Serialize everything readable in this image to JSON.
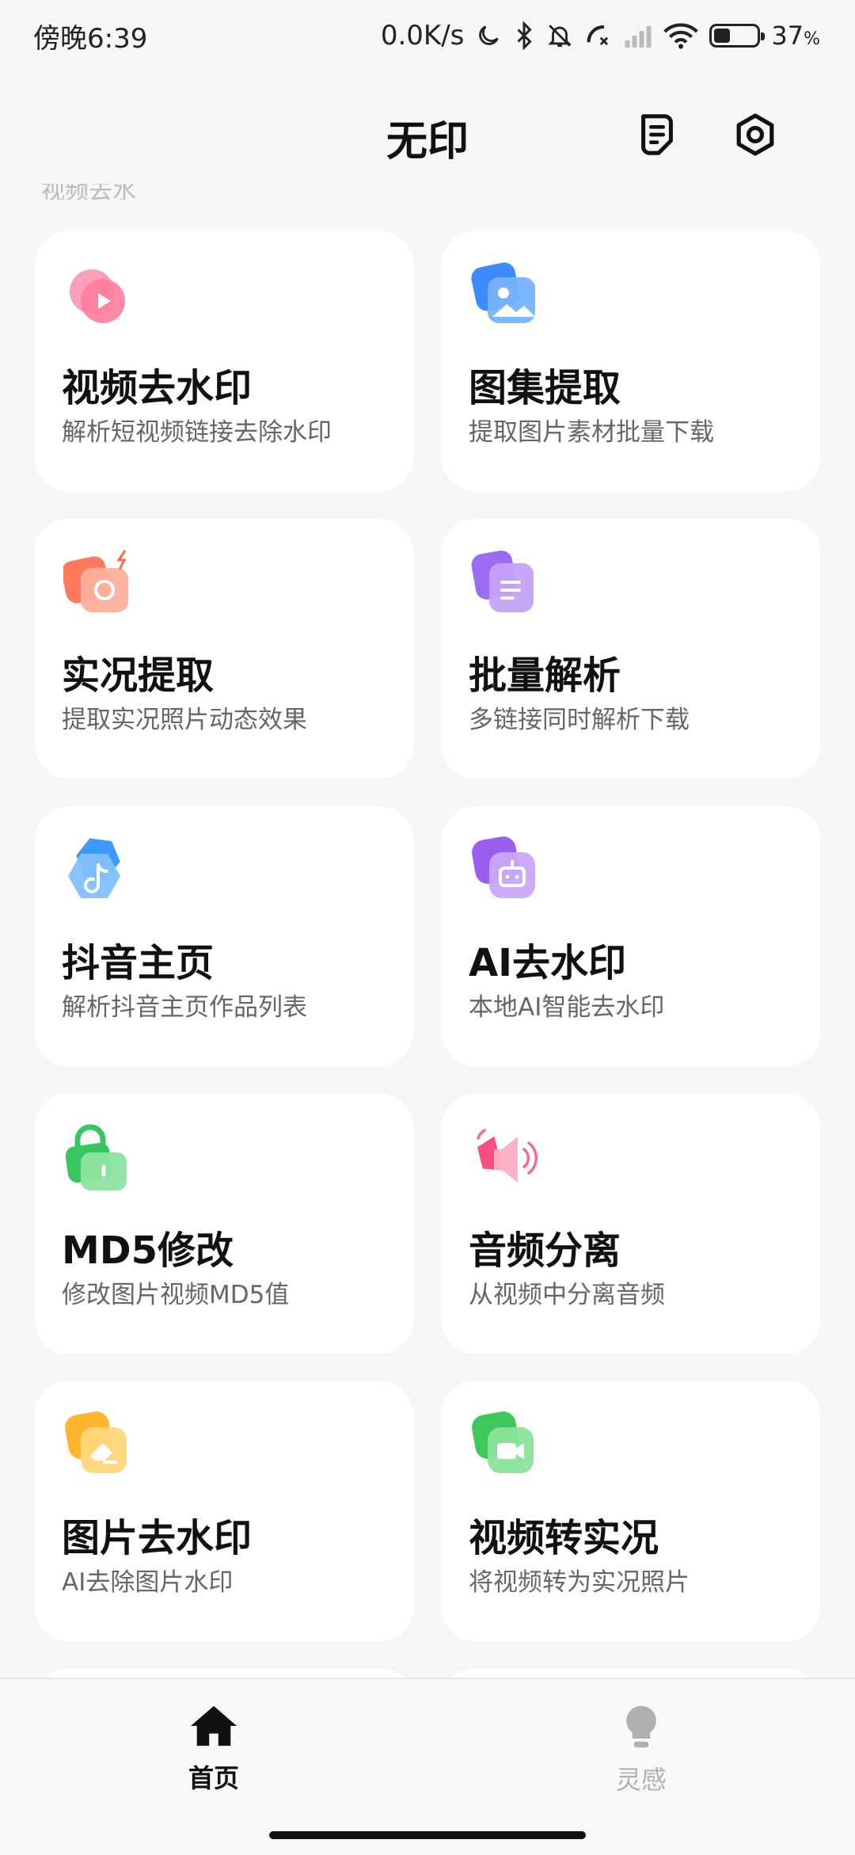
{
  "status": {
    "time": "傍晚6:39",
    "net_speed": "0.0K/s",
    "battery_pct": "37",
    "battery_unit": "%",
    "battery_level": 0.37
  },
  "header": {
    "title": "无印",
    "peek_text": "视频去水"
  },
  "tools": [
    {
      "title": "视频去水印",
      "subtitle": "解析短视频链接去除水印",
      "icon": "video-play-icon",
      "color": "#f5507f"
    },
    {
      "title": "图集提取",
      "subtitle": "提取图片素材批量下载",
      "icon": "image-gallery-icon",
      "color": "#3d8bff"
    },
    {
      "title": "实况提取",
      "subtitle": "提取实况照片动态效果",
      "icon": "live-camera-icon",
      "color": "#ff7a5c"
    },
    {
      "title": "批量解析",
      "subtitle": "多链接同时解析下载",
      "icon": "document-stack-icon",
      "color": "#9b6bf2"
    },
    {
      "title": "抖音主页",
      "subtitle": "解析抖音主页作品列表",
      "icon": "tiktok-icon",
      "color": "#3d9bff"
    },
    {
      "title": "AI去水印",
      "subtitle": "本地AI智能去水印",
      "icon": "robot-icon",
      "color": "#9a5ff0"
    },
    {
      "title": "MD5修改",
      "subtitle": "修改图片视频MD5值",
      "icon": "lock-icon",
      "color": "#38c75e"
    },
    {
      "title": "音频分离",
      "subtitle": "从视频中分离音频",
      "icon": "speaker-icon",
      "color": "#f56a8e"
    },
    {
      "title": "图片去水印",
      "subtitle": "AI去除图片水印",
      "icon": "eraser-icon",
      "color": "#ffb52e"
    },
    {
      "title": "视频转实况",
      "subtitle": "将视频转为实况照片",
      "icon": "video-camera-icon",
      "color": "#3cc85a"
    }
  ],
  "nav": {
    "home": "首页",
    "inspiration": "灵感"
  },
  "colors": {
    "active_nav": "#111111",
    "inactive_nav": "#b0b0b0"
  }
}
